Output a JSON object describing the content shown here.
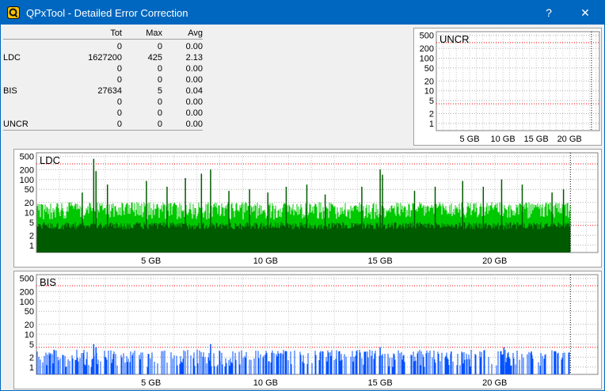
{
  "window": {
    "title": "QPxTool - Detailed Error Correction",
    "help_label": "?",
    "close_label": "✕",
    "colors": {
      "titlebar": "#0067c0",
      "background": "#f0f0f0"
    }
  },
  "stats": {
    "headers": [
      "",
      "Tot",
      "Max",
      "Avg"
    ],
    "rows": [
      [
        "",
        "0",
        "0",
        "0.00"
      ],
      [
        "LDC",
        "1627200",
        "425",
        "2.13"
      ],
      [
        "",
        "0",
        "0",
        "0.00"
      ],
      [
        "",
        "0",
        "0",
        "0.00"
      ],
      [
        "BIS",
        "27634",
        "5",
        "0.04"
      ],
      [
        "",
        "0",
        "0",
        "0.00"
      ],
      [
        "",
        "0",
        "0",
        "0.00"
      ],
      [
        "UNCR",
        "0",
        "0",
        "0.00"
      ]
    ]
  },
  "chart_data": [
    {
      "type": "bar",
      "title": "UNCR",
      "y_scale": "log",
      "y_ticks": [
        "500",
        "200",
        "100",
        "50",
        "20",
        "10",
        "5",
        "2",
        "1"
      ],
      "x_ticks": [
        "5 GB",
        "10 GB",
        "15 GB",
        "20 GB"
      ],
      "x_range_gb": [
        0,
        24.5
      ],
      "disc_end_gb": 23.3,
      "series": [
        {
          "color": "#ff0000",
          "values": []
        }
      ]
    },
    {
      "type": "bar",
      "title": "LDC",
      "y_scale": "log",
      "y_ticks": [
        "500",
        "200",
        "100",
        "50",
        "20",
        "10",
        "5",
        "2",
        "1"
      ],
      "x_ticks": [
        "5 GB",
        "10 GB",
        "15 GB",
        "20 GB"
      ],
      "x_range_gb": [
        0,
        24.5
      ],
      "disc_end_gb": 23.3,
      "typical_level": 12,
      "max_value": 425,
      "spikes": [
        {
          "x": 2.0,
          "y": 40
        },
        {
          "x": 2.5,
          "y": 425
        },
        {
          "x": 2.6,
          "y": 180
        },
        {
          "x": 3.1,
          "y": 70
        },
        {
          "x": 4.8,
          "y": 90
        },
        {
          "x": 5.7,
          "y": 60
        },
        {
          "x": 6.5,
          "y": 110
        },
        {
          "x": 7.2,
          "y": 150
        },
        {
          "x": 7.6,
          "y": 200
        },
        {
          "x": 8.4,
          "y": 45
        },
        {
          "x": 9.3,
          "y": 50
        },
        {
          "x": 10.1,
          "y": 40
        },
        {
          "x": 10.9,
          "y": 60
        },
        {
          "x": 11.8,
          "y": 70
        },
        {
          "x": 12.6,
          "y": 35
        },
        {
          "x": 14.2,
          "y": 60
        },
        {
          "x": 15.0,
          "y": 200
        },
        {
          "x": 15.1,
          "y": 140
        },
        {
          "x": 16.5,
          "y": 45
        },
        {
          "x": 17.4,
          "y": 60
        },
        {
          "x": 18.6,
          "y": 90
        },
        {
          "x": 19.5,
          "y": 60
        },
        {
          "x": 20.3,
          "y": 100
        },
        {
          "x": 21.2,
          "y": 70
        },
        {
          "x": 22.5,
          "y": 40
        },
        {
          "x": 23.0,
          "y": 50
        }
      ],
      "series": [
        {
          "color": "#00c800"
        },
        {
          "color": "#005a00"
        }
      ]
    },
    {
      "type": "bar",
      "title": "BIS",
      "y_scale": "log",
      "y_ticks": [
        "500",
        "200",
        "100",
        "50",
        "20",
        "10",
        "5",
        "2",
        "1"
      ],
      "x_ticks": [
        "5 GB",
        "10 GB",
        "15 GB",
        "20 GB"
      ],
      "x_range_gb": [
        0,
        24.5
      ],
      "disc_end_gb": 23.3,
      "typical_level": 2,
      "max_value": 5,
      "spikes": [
        {
          "x": 2.5,
          "y": 5
        },
        {
          "x": 2.6,
          "y": 4
        },
        {
          "x": 7.6,
          "y": 5
        },
        {
          "x": 8.0,
          "y": 3
        },
        {
          "x": 13.2,
          "y": 3
        },
        {
          "x": 15.0,
          "y": 4
        },
        {
          "x": 18.1,
          "y": 3
        },
        {
          "x": 20.4,
          "y": 4
        },
        {
          "x": 21.6,
          "y": 3
        },
        {
          "x": 22.6,
          "y": 3
        }
      ],
      "series": [
        {
          "color": "#0050ff"
        }
      ]
    }
  ]
}
